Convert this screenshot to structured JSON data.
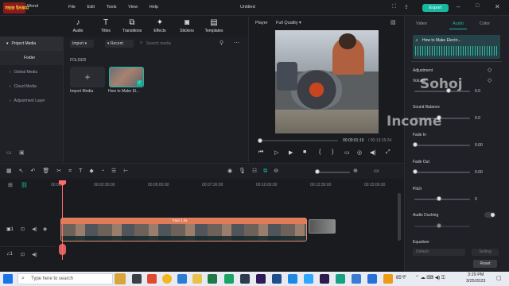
{
  "app": {
    "name": "Wond",
    "menu": [
      "File",
      "Edit",
      "Tools",
      "View",
      "Help"
    ],
    "project_title": "Untitled",
    "export_label": "Export"
  },
  "toolbar": [
    {
      "label": "Audio",
      "icon": "♪"
    },
    {
      "label": "Titles",
      "icon": "T"
    },
    {
      "label": "Transitions",
      "icon": "⧉"
    },
    {
      "label": "Effects",
      "icon": "✦"
    },
    {
      "label": "Stickers",
      "icon": "◙"
    },
    {
      "label": "Templates",
      "icon": "▤"
    }
  ],
  "sidebar": {
    "items": [
      {
        "label": "Project Media"
      },
      {
        "label": "Folder"
      },
      {
        "label": "Global Media"
      },
      {
        "label": "Cloud Media"
      },
      {
        "label": "Adjustment Layer"
      }
    ]
  },
  "media": {
    "import_label": "Import",
    "recent_label": "Recent",
    "search_placeholder": "Search media",
    "folder_label": "FOLDER",
    "import_media_label": "Import Media",
    "clip_label": "How to Make El..."
  },
  "player": {
    "label": "Player",
    "quality": "Full Quality",
    "time_current": "00:00:01:19",
    "time_total": "/ 00:13:15:24",
    "progress": 0.02
  },
  "right_panel": {
    "tabs": [
      "Video",
      "Audio",
      "Color"
    ],
    "active_tab": "Audio",
    "clip_name": "How to Make Electri...",
    "adjustment_label": "Adjustment",
    "volume_label": "Volume",
    "volume_value": "0.0",
    "balance_label": "Sound Balance",
    "balance_value": "0.0",
    "fadein_label": "Fade In",
    "fadein_value": "0.00",
    "fadeout_label": "Fade Out",
    "fadeout_value": "0.00",
    "pitch_label": "Pitch",
    "pitch_value": "0",
    "ducking_label": "Audio Ducking",
    "ducking_value": "",
    "equalizer_label": "Equalizer",
    "equalizer_value": "Default",
    "setting_label": "Setting",
    "reset_label": "Reset"
  },
  "timeline": {
    "ticks": [
      "00:00",
      "00:02:30:00",
      "00:05:00:00",
      "00:07:30:00",
      "00:10:00:00",
      "00:12:30:00",
      "00:15:00:00"
    ],
    "clip_title": "Fast 1.0x"
  },
  "watermark": {
    "line1": "Sohoj",
    "line2": "Income",
    "logo_text": "সহজ ইনকাম"
  },
  "taskbar": {
    "search_placeholder": "Type here to search",
    "temperature": "85°F",
    "time": "3:29 PM",
    "date": "3/25/2023"
  },
  "colors": {
    "accent": "#18b8a0",
    "clip": "#e07b5a",
    "playhead": "#ff6a6a"
  }
}
